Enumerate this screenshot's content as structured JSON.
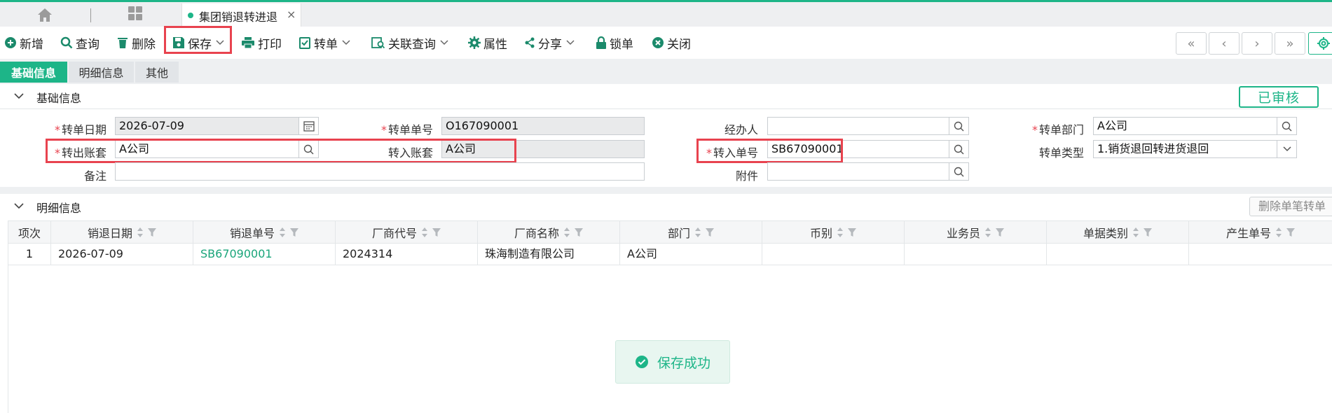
{
  "tabs": {
    "active_title": "集团销退转进退",
    "close_glyph": "×"
  },
  "toolbar": {
    "new": "新增",
    "query": "查询",
    "delete": "删除",
    "save": "保存",
    "print": "打印",
    "convert": "转单",
    "related_query": "关联查询",
    "properties": "属性",
    "share": "分享",
    "lock": "锁单",
    "close": "关闭"
  },
  "nav": {
    "first": "«",
    "prev": "‹",
    "next": "›",
    "last": "»"
  },
  "subtabs": [
    "基础信息",
    "明细信息",
    "其他"
  ],
  "basic": {
    "section_title": "基础信息",
    "status": "已审核",
    "fields": {
      "transfer_date": {
        "label": "转单日期",
        "value": "2026-07-09"
      },
      "transfer_no": {
        "label": "转单单号",
        "value": "O167090001"
      },
      "handler": {
        "label": "经办人",
        "value": ""
      },
      "transfer_dept": {
        "label": "转单部门",
        "value": "A公司"
      },
      "out_book": {
        "label": "转出账套",
        "value": "A公司"
      },
      "in_book": {
        "label": "转入账套",
        "value": "A公司"
      },
      "in_no": {
        "label": "转入单号",
        "value": "SB67090001"
      },
      "transfer_type": {
        "label": "转单类型",
        "value": "1.销货退回转进货退回"
      },
      "remark": {
        "label": "备注",
        "value": ""
      },
      "attachment": {
        "label": "附件",
        "value": ""
      }
    },
    "required_mark": "*"
  },
  "detail": {
    "section_title": "明细信息",
    "delete_button": "删除单笔转单",
    "columns": [
      "项次",
      "销退日期",
      "销退单号",
      "厂商代号",
      "厂商名称",
      "部门",
      "币别",
      "业务员",
      "单据类别",
      "产生单号"
    ],
    "rows": [
      [
        "1",
        "2026-07-09",
        "SB67090001",
        "2024314",
        "珠海制造有限公司",
        "A公司",
        "",
        "",
        "",
        ""
      ]
    ]
  },
  "toast": {
    "message": "保存成功"
  },
  "colors": {
    "accent": "#1db588",
    "highlight": "#e8434f",
    "link": "#1aa57a"
  }
}
